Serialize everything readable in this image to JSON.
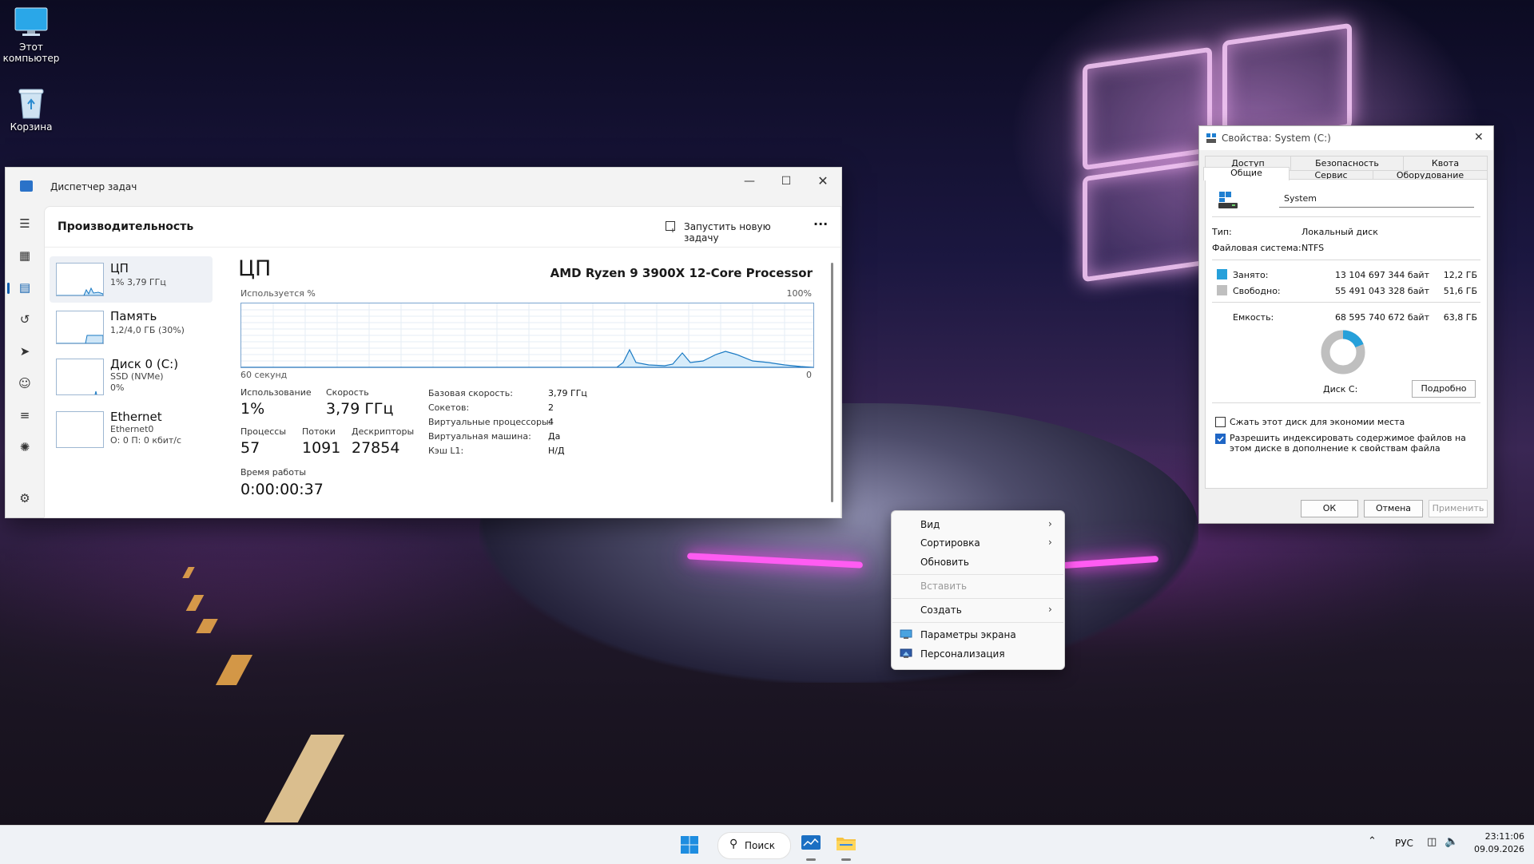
{
  "desktop": {
    "icons": [
      {
        "label": "Этот компьютер"
      },
      {
        "label": "Корзина"
      }
    ]
  },
  "task_manager": {
    "title": "Диспетчер задач",
    "section_title": "Производительность",
    "new_task_label": "Запустить новую задачу",
    "more_label": "···",
    "sidebar": [
      {
        "name": "ЦП",
        "detail": "1% 3,79 ГГц"
      },
      {
        "name": "Память",
        "detail": "1,2/4,0 ГБ (30%)"
      },
      {
        "name": "Диск 0 (C:)",
        "detail": "SSD (NVMe)",
        "detail2": "0%"
      },
      {
        "name": "Ethernet",
        "detail": "Ethernet0",
        "detail2": "О: 0 П: 0 кбит/с"
      }
    ],
    "cpu": {
      "heading": "ЦП",
      "processor": "AMD Ryzen 9 3900X 12-Core Processor",
      "graph_label": "Используется %",
      "graph_max": "100%",
      "graph_time": "60 секунд",
      "graph_min": "0",
      "usage_label": "Использование",
      "usage_value": "1%",
      "speed_label": "Скорость",
      "speed_value": "3,79 ГГц",
      "processes_label": "Процессы",
      "processes_value": "57",
      "threads_label": "Потоки",
      "threads_value": "1091",
      "handles_label": "Дескрипторы",
      "handles_value": "27854",
      "uptime_label": "Время работы",
      "uptime_value": "0:00:00:37",
      "details": [
        {
          "k": "Базовая скорость:",
          "v": "3,79 ГГц"
        },
        {
          "k": "Сокетов:",
          "v": "2"
        },
        {
          "k": "Виртуальные процессоры:",
          "v": "4"
        },
        {
          "k": "Виртуальная машина:",
          "v": "Да"
        },
        {
          "k": "Кэш L1:",
          "v": "Н/Д"
        }
      ]
    }
  },
  "properties": {
    "title": "Свойства: System (C:)",
    "tabs_top": [
      "Доступ",
      "Безопасность",
      "Квота"
    ],
    "tabs_bottom": [
      "Общие",
      "Сервис",
      "Оборудование"
    ],
    "volume_name": "System",
    "type_label": "Тип:",
    "type_value": "Локальный диск",
    "fs_label": "Файловая система:",
    "fs_value": "NTFS",
    "used_label": "Занято:",
    "used_bytes": "13 104 697 344 байт",
    "used_gb": "12,2 ГБ",
    "free_label": "Свободно:",
    "free_bytes": "55 491 043 328 байт",
    "free_gb": "51,6 ГБ",
    "capacity_label": "Емкость:",
    "capacity_bytes": "68 595 740 672 байт",
    "capacity_gb": "63,8 ГБ",
    "disk_label": "Диск C:",
    "details_button": "Подробно",
    "compress_label": "Сжать этот диск для экономии места",
    "index_label": "Разрешить индексировать содержимое файлов на этом диске в дополнение к свойствам файла",
    "used_fraction": 0.19,
    "used_color": "#26a0da",
    "free_color": "#bfbfbf",
    "ok": "ОК",
    "cancel": "Отмена",
    "apply": "Применить"
  },
  "context_menu": {
    "view": "Вид",
    "sort": "Сортировка",
    "refresh": "Обновить",
    "paste": "Вставить",
    "create": "Создать",
    "display": "Параметры экрана",
    "personalize": "Персонализация"
  },
  "taskbar": {
    "search": "Поиск",
    "lang": "РУС",
    "time": "23:11:06",
    "date": "09.09.2026"
  }
}
